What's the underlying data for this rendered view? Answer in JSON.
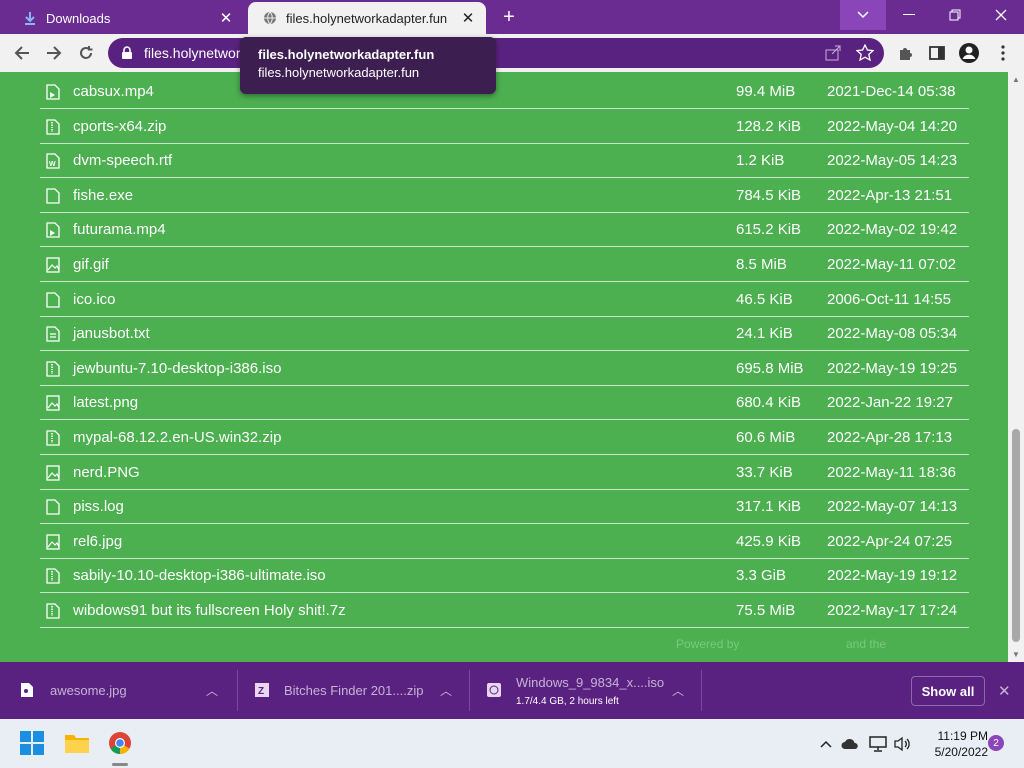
{
  "browser": {
    "tabs": [
      {
        "title": "Downloads",
        "icon": "download-icon"
      },
      {
        "title": "files.holynetworkadapter.fun",
        "icon": "globe-icon"
      }
    ],
    "url": "files.holynetwor",
    "tooltip": {
      "title": "files.holynetworkadapter.fun",
      "host": "files.holynetworkadapter.fun"
    }
  },
  "files": [
    {
      "name": "cabsux.mp4",
      "size": "99.4 MiB",
      "date": "2021-Dec-14 05:38",
      "type": "video"
    },
    {
      "name": "cports-x64.zip",
      "size": "128.2 KiB",
      "date": "2022-May-04 14:20",
      "type": "archive"
    },
    {
      "name": "dvm-speech.rtf",
      "size": "1.2 KiB",
      "date": "2022-May-05 14:23",
      "type": "word"
    },
    {
      "name": "fishe.exe",
      "size": "784.5 KiB",
      "date": "2022-Apr-13 21:51",
      "type": "file"
    },
    {
      "name": "futurama.mp4",
      "size": "615.2 KiB",
      "date": "2022-May-02 19:42",
      "type": "video"
    },
    {
      "name": "gif.gif",
      "size": "8.5 MiB",
      "date": "2022-May-11 07:02",
      "type": "image"
    },
    {
      "name": "ico.ico",
      "size": "46.5 KiB",
      "date": "2006-Oct-11 14:55",
      "type": "file"
    },
    {
      "name": "janusbot.txt",
      "size": "24.1 KiB",
      "date": "2022-May-08 05:34",
      "type": "text"
    },
    {
      "name": "jewbuntu-7.10-desktop-i386.iso",
      "size": "695.8 MiB",
      "date": "2022-May-19 19:25",
      "type": "archive"
    },
    {
      "name": "latest.png",
      "size": "680.4 KiB",
      "date": "2022-Jan-22 19:27",
      "type": "image"
    },
    {
      "name": "mypal-68.12.2.en-US.win32.zip",
      "size": "60.6 MiB",
      "date": "2022-Apr-28 17:13",
      "type": "archive"
    },
    {
      "name": "nerd.PNG",
      "size": "33.7 KiB",
      "date": "2022-May-11 18:36",
      "type": "image"
    },
    {
      "name": "piss.log",
      "size": "317.1 KiB",
      "date": "2022-May-07 14:13",
      "type": "file"
    },
    {
      "name": "rel6.jpg",
      "size": "425.9 KiB",
      "date": "2022-Apr-24 07:25",
      "type": "image"
    },
    {
      "name": "sabily-10.10-desktop-i386-ultimate.iso",
      "size": "3.3 GiB",
      "date": "2022-May-19 19:12",
      "type": "archive"
    },
    {
      "name": "wibdows91 but its fullscreen Holy shit!.7z",
      "size": "75.5 MiB",
      "date": "2022-May-17 17:24",
      "type": "archive"
    }
  ],
  "footer": {
    "powered": "Powered by",
    "and": "and the"
  },
  "downloads": [
    {
      "name": "awesome.jpg",
      "status": ""
    },
    {
      "name": "Bitches Finder 201....zip",
      "status": ""
    },
    {
      "name": "Windows_9_9834_x....iso",
      "status": "1.7/4.4 GB, 2 hours left"
    }
  ],
  "download_bar": {
    "show_all": "Show all"
  },
  "taskbar": {
    "time": "11:19 PM",
    "date": "5/20/2022",
    "notifications": "2"
  },
  "colors": {
    "page_bg": "#4caf50",
    "accent": "#6a2c91"
  }
}
